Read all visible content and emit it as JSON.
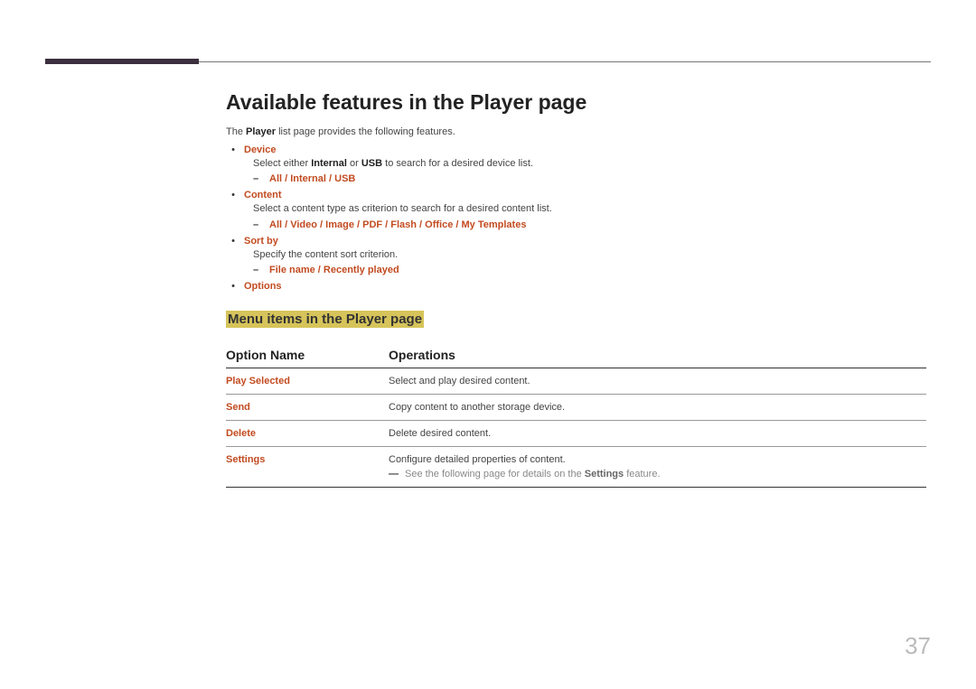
{
  "heading": "Available features in the Player page",
  "intro_prefix": "The ",
  "intro_bold": "Player",
  "intro_suffix": " list page provides the following features.",
  "features": [
    {
      "label": "Device",
      "desc_pre": "Select either ",
      "desc_b1": "Internal",
      "desc_mid": " or ",
      "desc_b2": "USB",
      "desc_post": " to search for a desired device list.",
      "sub": "All / Internal / USB"
    },
    {
      "label": "Content",
      "desc_plain": "Select a content type as criterion to search for a desired content list.",
      "sub": "All / Video / Image / PDF / Flash / Office / My Templates"
    },
    {
      "label": "Sort by",
      "desc_plain": "Specify the content sort criterion.",
      "sub": "File name / Recently played"
    },
    {
      "label": "Options"
    }
  ],
  "section_heading": "Menu items in the Player page",
  "table": {
    "head_name": "Option Name",
    "head_ops": "Operations",
    "rows": [
      {
        "name": "Play Selected",
        "ops": "Select and play desired content."
      },
      {
        "name": "Send",
        "ops": "Copy content to another storage device."
      },
      {
        "name": "Delete",
        "ops": "Delete desired content."
      },
      {
        "name": "Settings",
        "ops": "Configure detailed properties of content."
      }
    ],
    "note_pre": "See the following page for details on the ",
    "note_bold": "Settings",
    "note_post": " feature."
  },
  "page_number": "37"
}
